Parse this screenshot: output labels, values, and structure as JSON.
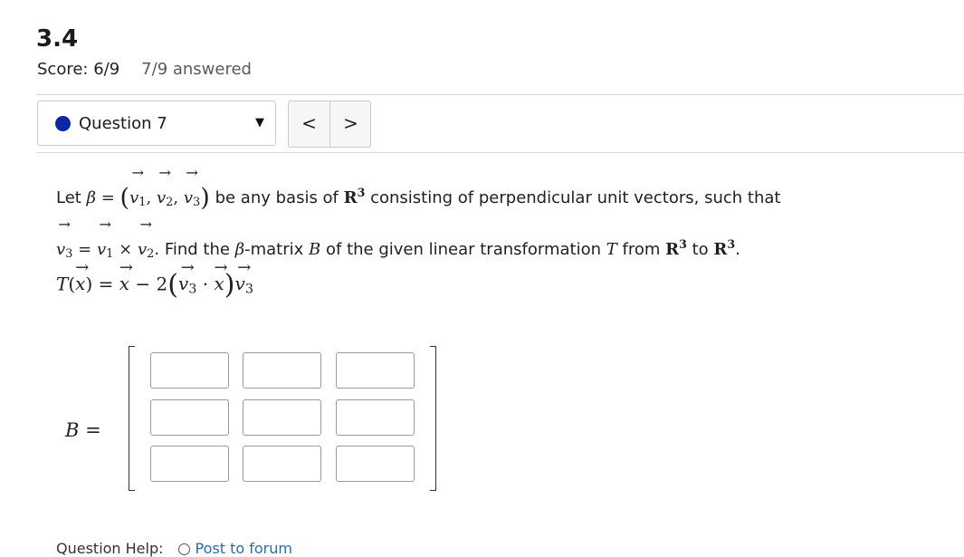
{
  "section": {
    "title": "3.4"
  },
  "score": {
    "text": "Score: 6/9",
    "answered": "7/9 answered"
  },
  "question_selector": {
    "label": "Question 7",
    "status_color": "#0b26a6"
  },
  "navigation": {
    "prev": "<",
    "next": ">"
  },
  "prompt": {
    "let": "Let",
    "beta": "β",
    "eq": "=",
    "v": "v",
    "s1": "1",
    "s2": "2",
    "s3": "3",
    "comma": ",",
    "be_any_basis": "be any basis of",
    "R": "R",
    "exp3": "3",
    "consisting": "consisting of perpendicular unit vectors, such that",
    "times": "×",
    "find_the": ". Find the",
    "matrix_word": "-matrix",
    "B": "B",
    "of_the_given": "of the given linear transformation",
    "T": "T",
    "from": "from",
    "to": "to",
    "period": "."
  },
  "formula": {
    "T": "T",
    "x": "x",
    "eq": "=",
    "minus": "−",
    "two": "2",
    "dot": "·",
    "v": "v",
    "sub3": "3"
  },
  "matrix": {
    "label": "B =",
    "cells": [
      "",
      "",
      "",
      "",
      "",
      "",
      "",
      "",
      ""
    ]
  },
  "help": {
    "label": "Question Help:",
    "forum_link": "Post to forum"
  }
}
